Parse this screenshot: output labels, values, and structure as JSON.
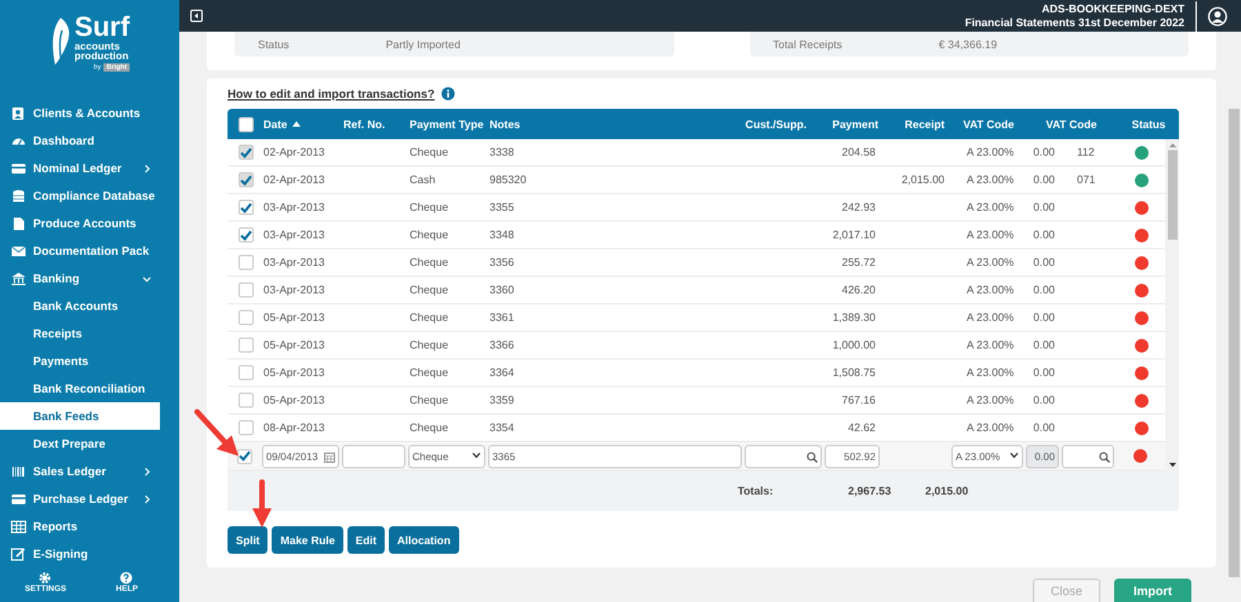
{
  "sidebar": {
    "logo": {
      "title": "Surf",
      "subtitle_1": "accounts",
      "subtitle_2": "production",
      "by": "by",
      "brand": "Bright"
    },
    "items": [
      {
        "label": "Clients & Accounts",
        "kind": "main",
        "selected": false
      },
      {
        "label": "Dashboard",
        "kind": "main",
        "selected": false
      },
      {
        "label": "Nominal Ledger",
        "kind": "main",
        "selected": false,
        "expanded": false
      },
      {
        "label": "Compliance Database",
        "kind": "main",
        "selected": false
      },
      {
        "label": "Produce Accounts",
        "kind": "main",
        "selected": false
      },
      {
        "label": "Documentation Pack",
        "kind": "main",
        "selected": false
      },
      {
        "label": "Banking",
        "kind": "main",
        "selected": false,
        "expanded": true
      },
      {
        "label": "Bank Accounts",
        "kind": "sub",
        "selected": false
      },
      {
        "label": "Receipts",
        "kind": "sub",
        "selected": false
      },
      {
        "label": "Payments",
        "kind": "sub",
        "selected": false
      },
      {
        "label": "Bank Reconciliation",
        "kind": "sub",
        "selected": false
      },
      {
        "label": "Bank Feeds",
        "kind": "sub",
        "selected": true
      },
      {
        "label": "Dext Prepare",
        "kind": "sub",
        "selected": false
      },
      {
        "label": "Sales Ledger",
        "kind": "main",
        "selected": false,
        "expanded": false
      },
      {
        "label": "Purchase Ledger",
        "kind": "main",
        "selected": false,
        "expanded": false
      },
      {
        "label": "Reports",
        "kind": "main",
        "selected": false
      },
      {
        "label": "E-Signing",
        "kind": "main",
        "selected": false
      }
    ],
    "footer": [
      "SETTINGS",
      "HELP"
    ]
  },
  "top_bar": {
    "client": "ADS-BOOKKEEPING-DEXT",
    "period": "Financial Statements 31st December 2022"
  },
  "summary": [
    {
      "label": "Status",
      "value": "Partly Imported"
    },
    {
      "label": "Total Receipts",
      "value": "€ 34,366.19"
    }
  ],
  "help_link": "How to edit and import transactions?",
  "table": {
    "select_all": {
      "checked": false
    },
    "columns": [
      {
        "label": "Date",
        "sorted": true
      },
      {
        "label": "Ref. No."
      },
      {
        "label": "Payment Type"
      },
      {
        "label": "Notes"
      },
      {
        "label": "Cust./Supp."
      },
      {
        "label": "Payment"
      },
      {
        "label": "Receipt"
      },
      {
        "label": "VAT Code"
      },
      {
        "label": "VAT Code"
      },
      {
        "label": "Status"
      }
    ],
    "rows": [
      {
        "checked": true,
        "disabled": true,
        "date": "02-Apr-2013",
        "payment_type": "Cheque",
        "notes": "3338",
        "payment": "204.58",
        "vat_code": "A 23.00%",
        "vat_amount": "0.00",
        "code": "112",
        "color": "#27a07c"
      },
      {
        "checked": true,
        "disabled": true,
        "date": "02-Apr-2013",
        "payment_type": "Cash",
        "notes": "985320",
        "receipt": "2,015.00",
        "vat_code": "A 23.00%",
        "vat_amount": "0.00",
        "code": "071",
        "color": "#27a07c"
      },
      {
        "checked": true,
        "disabled": false,
        "date": "03-Apr-2013",
        "payment_type": "Cheque",
        "notes": "3355",
        "payment": "242.93",
        "vat_code": "A 23.00%",
        "vat_amount": "0.00",
        "color": "#f03a2e"
      },
      {
        "checked": true,
        "disabled": false,
        "date": "03-Apr-2013",
        "payment_type": "Cheque",
        "notes": "3348",
        "payment": "2,017.10",
        "vat_code": "A 23.00%",
        "vat_amount": "0.00",
        "color": "#f03a2e"
      },
      {
        "checked": false,
        "disabled": false,
        "date": "03-Apr-2013",
        "payment_type": "Cheque",
        "notes": "3356",
        "payment": "255.72",
        "vat_code": "A 23.00%",
        "vat_amount": "0.00",
        "color": "#f03a2e"
      },
      {
        "checked": false,
        "disabled": false,
        "date": "03-Apr-2013",
        "payment_type": "Cheque",
        "notes": "3360",
        "payment": "426.20",
        "vat_code": "A 23.00%",
        "vat_amount": "0.00",
        "color": "#f03a2e"
      },
      {
        "checked": false,
        "disabled": false,
        "date": "05-Apr-2013",
        "payment_type": "Cheque",
        "notes": "3361",
        "payment": "1,389.30",
        "vat_code": "A 23.00%",
        "vat_amount": "0.00",
        "color": "#f03a2e"
      },
      {
        "checked": false,
        "disabled": false,
        "date": "05-Apr-2013",
        "payment_type": "Cheque",
        "notes": "3366",
        "payment": "1,000.00",
        "vat_code": "A 23.00%",
        "vat_amount": "0.00",
        "color": "#f03a2e"
      },
      {
        "checked": false,
        "disabled": false,
        "date": "05-Apr-2013",
        "payment_type": "Cheque",
        "notes": "3364",
        "payment": "1,508.75",
        "vat_code": "A 23.00%",
        "vat_amount": "0.00",
        "color": "#f03a2e"
      },
      {
        "checked": false,
        "disabled": false,
        "date": "05-Apr-2013",
        "payment_type": "Cheque",
        "notes": "3359",
        "payment": "767.16",
        "vat_code": "A 23.00%",
        "vat_amount": "0.00",
        "color": "#f03a2e"
      },
      {
        "checked": false,
        "disabled": false,
        "date": "08-Apr-2013",
        "payment_type": "Cheque",
        "notes": "3354",
        "payment": "42.62",
        "vat_code": "A 23.00%",
        "vat_amount": "0.00",
        "color": "#f03a2e"
      }
    ],
    "edit_row": {
      "checked": true,
      "date": "09/04/2013",
      "payment_type": "Cheque",
      "notes": "3365",
      "payment": "502.92",
      "vat_code": "A 23.00%",
      "vat_amount": "0.00",
      "color": "#f03a2e"
    },
    "totals": {
      "label": "Totals:",
      "payment": "2,967.53",
      "receipt": "2,015.00"
    }
  },
  "actions": [
    "Split",
    "Make Rule",
    "Edit",
    "Allocation"
  ],
  "footer_buttons": [
    {
      "label": "Close",
      "kind": "secondary"
    },
    {
      "label": "Import",
      "kind": "primary"
    }
  ]
}
